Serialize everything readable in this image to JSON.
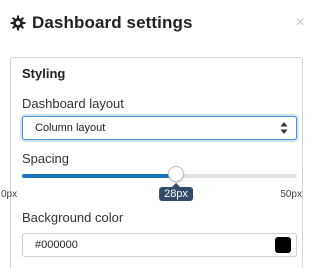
{
  "header": {
    "title": "Dashboard settings",
    "icon": "gear-icon",
    "close_label": "×"
  },
  "styling": {
    "section_title": "Styling",
    "layout_label": "Dashboard layout",
    "layout_value": "Column layout",
    "spacing_label": "Spacing",
    "spacing_value": "28px",
    "spacing_fraction": 0.56,
    "spacing_min": "0px",
    "spacing_max": "50px",
    "bg_label": "Background color",
    "bg_value": "#000000"
  },
  "colors": {
    "accent": "#1a73b8",
    "swatch": "#000000",
    "tooltip": "#334a68"
  }
}
